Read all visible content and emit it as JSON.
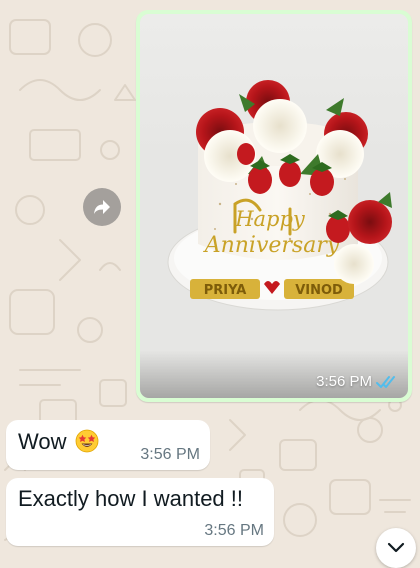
{
  "conversation": {
    "image_message": {
      "time": "3:56 PM",
      "status_icon": "double-check-read-icon",
      "photo": {
        "description_icon": "anniversary-cake-photo",
        "cake_topper_text_line1": "Happy",
        "cake_topper_text_line2": "Anniversary",
        "cake_plaque_left": "PRIYA",
        "cake_plaque_right": "VINOD"
      }
    },
    "forward_button": {
      "icon": "forward-arrow-icon"
    },
    "messages": [
      {
        "text": "Wow",
        "emoji": "star-struck-emoji",
        "time": "3:56 PM"
      },
      {
        "text": "Exactly how I wanted !!",
        "time": "3:56 PM"
      }
    ],
    "scroll_down_button": {
      "icon": "chevron-down-icon"
    }
  },
  "colors": {
    "chat_background": "#efe7dd",
    "outgoing_bubble": "#d9fdd3",
    "incoming_bubble": "#ffffff",
    "read_tick": "#53bdeb",
    "timestamp": "#667781"
  }
}
